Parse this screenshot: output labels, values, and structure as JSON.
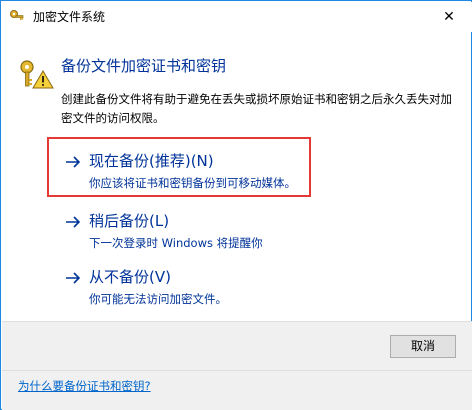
{
  "window": {
    "title": "加密文件系统",
    "close_glyph": "✕"
  },
  "header": {
    "title": "备份文件加密证书和密钥",
    "icon": "key-with-warning-icon"
  },
  "description": "创建此备份文件将有助于避免在丢失或损坏原始证书和密钥之后永久丢失对加密文件的访问权限。",
  "options": [
    {
      "title": "现在备份(推荐)(N)",
      "subtitle": "你应该将证书和密钥备份到可移动媒体。",
      "highlighted": true
    },
    {
      "title": "稍后备份(L)",
      "subtitle": "下一次登录时 Windows 将提醒你"
    },
    {
      "title": "从不备份(V)",
      "subtitle": "你可能无法访问加密文件。"
    }
  ],
  "footer": {
    "cancel_label": "取消",
    "help_link": "为什么要备份证书和密钥?"
  },
  "colors": {
    "accent": "#003399",
    "link": "#0066cc",
    "highlight_border": "#e53935",
    "window_border": "#1e88e5"
  }
}
